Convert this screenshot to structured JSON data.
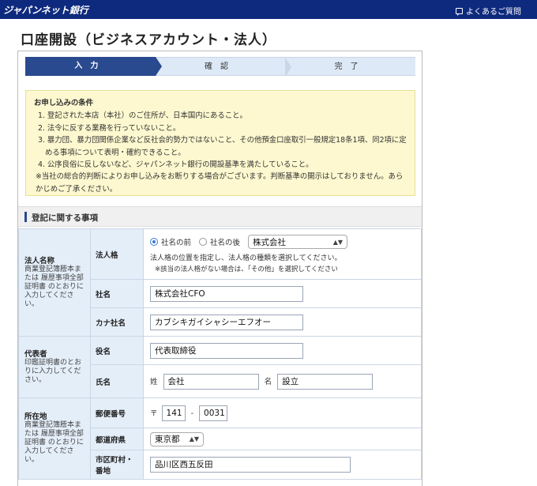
{
  "header": {
    "brand": "ジャパンネット銀行",
    "faq_label": "よくあるご質問",
    "faq_icon": "chat-bubble-icon"
  },
  "page": {
    "title": "口座開設（ビジネスアカウント・法人）"
  },
  "steps": [
    {
      "label": "入力"
    },
    {
      "label": "確認"
    },
    {
      "label": "完了"
    }
  ],
  "notice": {
    "title": "お申し込みの条件",
    "items": [
      "1. 登記された本店（本社）のご住所が、日本国内にあること。",
      "2. 法令に反する業務を行っていないこと。",
      "3. 暴力団、暴力団関係企業など反社会的勢力ではないこと、その他預金口座取引一般規定18条1項、同2項に定める事項について表明・確約できること。",
      "4. 公序良俗に反しないなど、ジャパンネット銀行の開設基準を満たしていること。"
    ],
    "note": "※当社の総合的判断によりお申し込みをお断りする場合がございます。判断基準の開示はしておりません。あらかじめご了承ください。"
  },
  "section": {
    "title": "登記に関する事項"
  },
  "groups": {
    "corp_name": {
      "title": "法人名称",
      "desc": "商業登記簿謄本または 履歴事項全部証明書 のとおりに入力してください。"
    },
    "representative": {
      "title": "代表者",
      "desc": "印鑑証明書のとおりに入力してください。"
    },
    "address": {
      "title": "所在地",
      "desc": "商業登記簿謄本または 履歴事項全部証明書 のとおりに入力してください。"
    }
  },
  "fields": {
    "corp_type": {
      "label": "法人格",
      "radio_before": "社名の前",
      "radio_after": "社名の後",
      "selected_position": "before",
      "select_value": "株式会社",
      "help": "法人格の位置を指定し、法人格の種類を選択してください。",
      "help_sub": "※該当の法人格がない場合は、「その他」を選択してください"
    },
    "company_name": {
      "label": "社名",
      "value": "株式会社CFO"
    },
    "company_kana": {
      "label": "カナ社名",
      "value": "カブシキガイシャシーエフオー"
    },
    "title": {
      "label": "役名",
      "value": "代表取締役"
    },
    "person_name": {
      "label": "氏名",
      "last_label": "姓",
      "last_value": "会社",
      "first_label": "名",
      "first_value": "設立"
    },
    "postal": {
      "label": "郵便番号",
      "mark": "〒",
      "part1": "141",
      "sep": "-",
      "part2": "0031"
    },
    "prefecture": {
      "label": "都道府県",
      "value": "東京都"
    },
    "city": {
      "label": "市区町村・番地",
      "value": "品川区西五反田"
    }
  }
}
